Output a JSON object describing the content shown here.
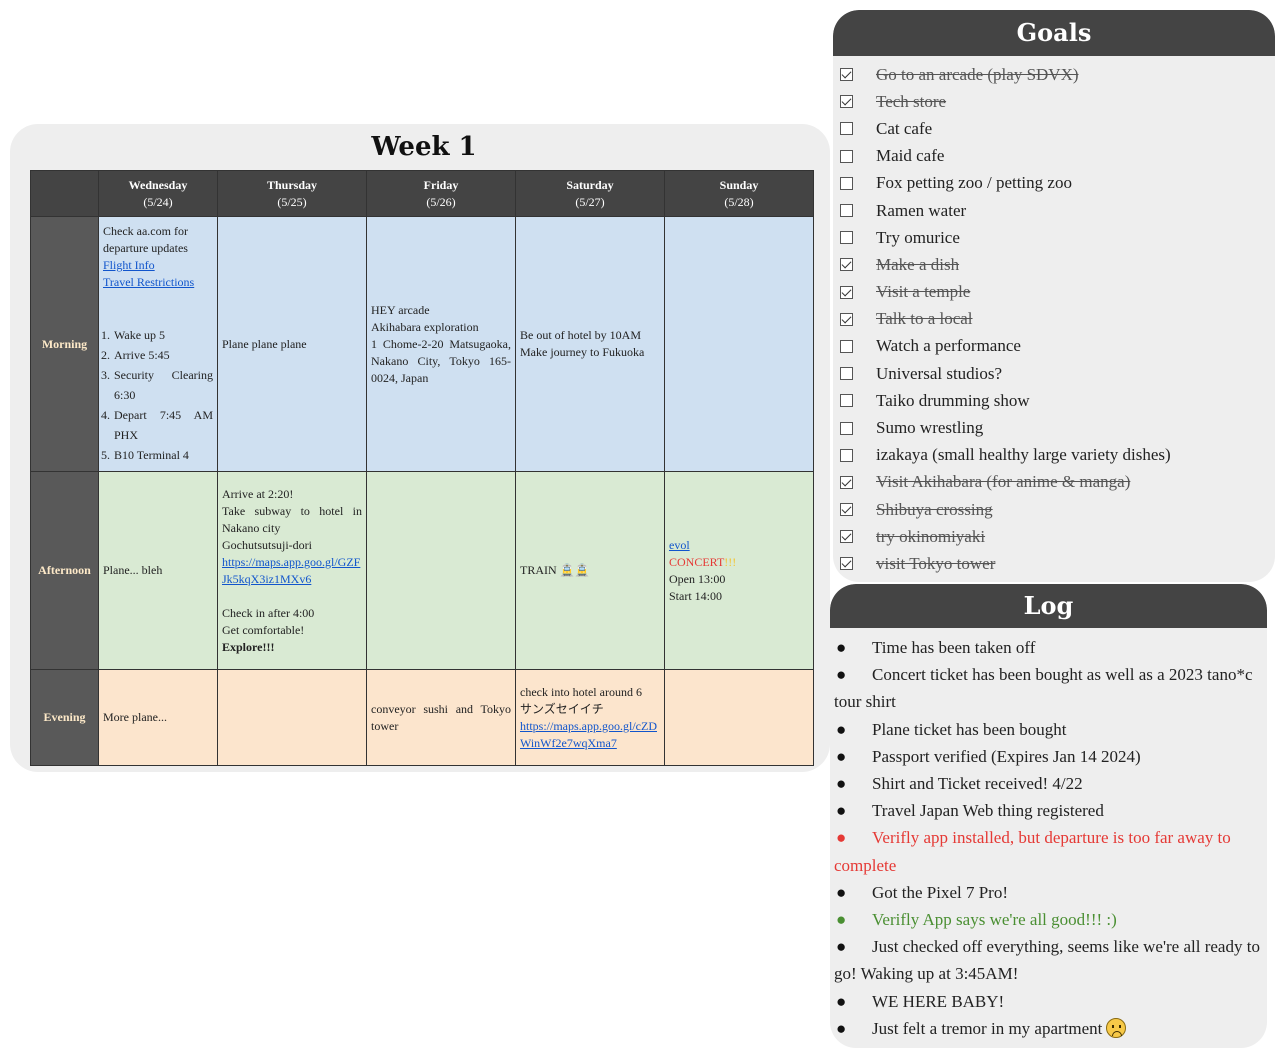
{
  "week": {
    "title": "Week 1",
    "days": [
      {
        "name": "Wednesday",
        "date": "(5/24)"
      },
      {
        "name": "Thursday",
        "date": "(5/25)"
      },
      {
        "name": "Friday",
        "date": "(5/26)"
      },
      {
        "name": "Saturday",
        "date": "(5/27)"
      },
      {
        "name": "Sunday",
        "date": "(5/28)"
      }
    ],
    "rows": {
      "morning": "Morning",
      "afternoon": "Afternoon",
      "evening": "Evening"
    },
    "morning": {
      "wed": {
        "line1": "Check aa.com for",
        "line2": "departure updates",
        "link1": "Flight Info",
        "link2": "Travel Restrictions",
        "list": [
          {
            "n": "1.",
            "t": "Wake up 5"
          },
          {
            "n": "2.",
            "t": "Arrive 5:45"
          },
          {
            "n": "3.",
            "t": "Security Clearing 6:30"
          },
          {
            "n": "4.",
            "t": "Depart 7:45 AM PHX"
          },
          {
            "n": "5.",
            "t": "B10 Terminal 4"
          }
        ]
      },
      "thu": "Plane plane plane",
      "fri": {
        "line1": "HEY arcade",
        "line2": "Akihabara exploration",
        "line3": "1 Chome-2-20 Matsugaoka, Nakano City, Tokyo 165-0024, Japan"
      },
      "sat": {
        "line1": "Be out of hotel by 10AM",
        "line2": "Make journey to Fukuoka"
      },
      "sun": ""
    },
    "afternoon": {
      "wed": "Plane... bleh",
      "thu": {
        "line1": "Arrive at 2:20!",
        "line2": "Take subway to hotel in Nakano city",
        "line3": "Gochutsutsuji-dori",
        "link": "https://maps.app.goo.gl/GZFJk5kqX3iz1MXv6",
        "line4": "Check in after 4:00",
        "line5": "Get comfortable!",
        "line6": "Explore!!!"
      },
      "fri": "",
      "sat": {
        "text": "TRAIN",
        "emoji": "🚊🚊"
      },
      "sun": {
        "link": "evol",
        "concert": "CONCERT",
        "concert_tail": "!!!",
        "line2": "Open 13:00",
        "line3": "Start 14:00"
      }
    },
    "evening": {
      "wed": "More plane...",
      "thu": "",
      "fri": "conveyor sushi and Tokyo tower",
      "sat": {
        "line1": "check into hotel around 6",
        "line2": "サンズセイイチ",
        "link": "https://maps.app.goo.gl/cZDWinWf2e7wqXma7"
      },
      "sun": ""
    }
  },
  "goals": {
    "title": "Goals",
    "items": [
      {
        "text": "Go to an arcade (play SDVX)",
        "done": true
      },
      {
        "text": "Tech store",
        "done": true
      },
      {
        "text": "Cat cafe",
        "done": false
      },
      {
        "text": "Maid cafe",
        "done": false
      },
      {
        "text": "Fox petting zoo / petting zoo",
        "done": false
      },
      {
        "text": "Ramen water",
        "done": false
      },
      {
        "text": "Try omurice",
        "done": false
      },
      {
        "text": "Make a dish",
        "done": true
      },
      {
        "text": "Visit a temple",
        "done": true
      },
      {
        "text": "Talk to a local",
        "done": true
      },
      {
        "text": "Watch a performance",
        "done": false
      },
      {
        "text": "Universal studios?",
        "done": false
      },
      {
        "text": "Taiko drumming show",
        "done": false
      },
      {
        "text": "Sumo wrestling",
        "done": false
      },
      {
        "text": "izakaya (small healthy large variety dishes)",
        "done": false
      },
      {
        "text": "Visit Akihabara (for anime & manga)",
        "done": true
      },
      {
        "text": "Shibuya crossing",
        "done": true
      },
      {
        "text": "try okinomiyaki",
        "done": true
      },
      {
        "text": "visit Tokyo tower",
        "done": true
      }
    ]
  },
  "log": {
    "title": "Log",
    "bullet": "●",
    "items": [
      {
        "text": "Time has been taken off",
        "color": ""
      },
      {
        "text": "Concert ticket has been bought as well as a 2023 tano*c tour shirt",
        "color": ""
      },
      {
        "text": "Plane ticket has been bought",
        "color": ""
      },
      {
        "text": "Passport verified (Expires Jan 14 2024)",
        "color": ""
      },
      {
        "text": "Shirt and Ticket received! 4/22",
        "color": ""
      },
      {
        "text": "Travel Japan Web thing registered",
        "color": ""
      },
      {
        "text": "Verifly app installed, but departure is too far away to complete",
        "color": "#e53935"
      },
      {
        "text": "Got the Pixel 7 Pro!",
        "color": ""
      },
      {
        "text": "Verifly App says we're all good!!! :)",
        "color": "#4a8f32"
      },
      {
        "text": "Just checked off everything, seems like we're all ready to go! Waking up at 3:45AM!",
        "color": ""
      },
      {
        "text": "WE HERE BABY!",
        "color": ""
      },
      {
        "text": "Just felt a tremor in my apartment",
        "color": "",
        "emoji": "worried-face-icon"
      }
    ]
  }
}
